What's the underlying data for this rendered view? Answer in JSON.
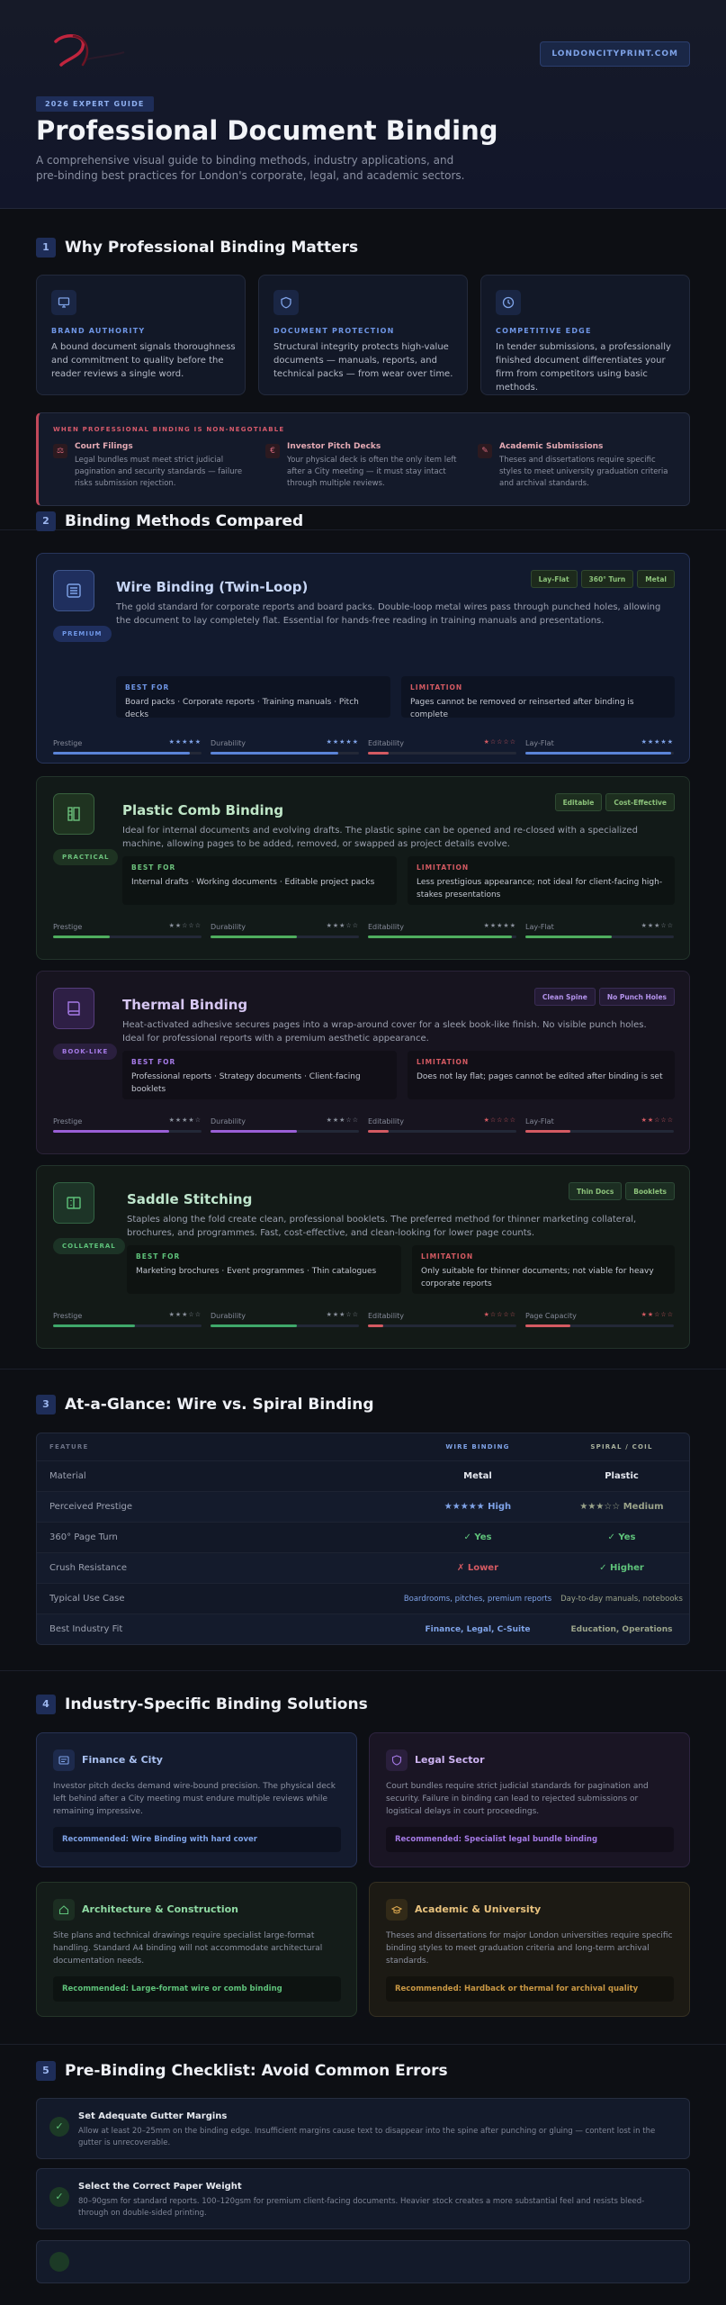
{
  "header": {
    "site_button": "LONDONCITYPRINT.COM",
    "badge": "2026 EXPERT GUIDE",
    "title": "Professional Document Binding",
    "subtitle": "A comprehensive visual guide to binding methods, industry applications, and pre-binding best practices for London's corporate, legal, and academic sectors."
  },
  "section1": {
    "number": "1",
    "title": "Why Professional Binding Matters",
    "cards": [
      {
        "icon": "monitor-icon",
        "eyebrow": "BRAND AUTHORITY",
        "text": "A bound document signals thoroughness and commitment to quality before the reader reviews a single word."
      },
      {
        "icon": "shield-icon",
        "eyebrow": "DOCUMENT PROTECTION",
        "text": "Structural integrity protects high-value documents — manuals, reports, and technical packs — from wear over time."
      },
      {
        "icon": "clock-icon",
        "eyebrow": "COMPETITIVE EDGE",
        "text": "In tender submissions, a professionally finished document differentiates your firm from competitors using basic methods."
      }
    ],
    "non_negotiable": {
      "label": "WHEN PROFESSIONAL BINDING IS NON-NEGOTIABLE",
      "items": [
        {
          "glyph": "⚖",
          "title": "Court Filings",
          "text": "Legal bundles must meet strict judicial pagination and security standards — failure risks submission rejection."
        },
        {
          "glyph": "€",
          "title": "Investor Pitch Decks",
          "text": "Your physical deck is often the only item left after a City meeting — it must stay intact through multiple reviews."
        },
        {
          "glyph": "✎",
          "title": "Academic Submissions",
          "text": "Theses and dissertations require specific styles to meet university graduation criteria and archival standards."
        }
      ]
    }
  },
  "section2": {
    "number": "2",
    "title": "Binding Methods Compared",
    "methods": [
      {
        "title": "Wire Binding (Twin-Loop)",
        "badge": "PREMIUM",
        "description": "The gold standard for corporate reports and board packs. Double-loop metal wires pass through punched holes, allowing the document to lay completely flat. Essential for hands-free reading in training manuals and presentations.",
        "tags": [
          "Lay-Flat",
          "360° Turn",
          "Metal"
        ],
        "best_for_label": "BEST FOR",
        "best_for": "Board packs · Corporate reports · Training manuals · Pitch decks",
        "limitation_label": "LIMITATION",
        "limitation": "Pages cannot be removed or reinserted after binding is complete",
        "metrics": [
          {
            "name": "Prestige",
            "stars": "★★★★★",
            "level": 0.92
          },
          {
            "name": "Durability",
            "stars": "★★★★★",
            "level": 0.86
          },
          {
            "name": "Editability",
            "stars": "★☆☆☆☆",
            "level": 0.14
          },
          {
            "name": "Lay-Flat",
            "stars": "★★★★★",
            "level": 0.98
          }
        ]
      },
      {
        "title": "Plastic Comb Binding",
        "badge": "PRACTICAL",
        "description": "Ideal for internal documents and evolving drafts. The plastic spine can be opened and re-closed with a specialized machine, allowing pages to be added, removed, or swapped as project details evolve.",
        "tags": [
          "Editable",
          "Cost-Effective"
        ],
        "best_for_label": "BEST FOR",
        "best_for": "Internal drafts · Working documents · Editable project packs",
        "limitation_label": "LIMITATION",
        "limitation": "Less prestigious appearance; not ideal for client-facing high-stakes presentations",
        "metrics": [
          {
            "name": "Prestige",
            "stars": "★★☆☆☆",
            "level": 0.38
          },
          {
            "name": "Durability",
            "stars": "★★★☆☆",
            "level": 0.58
          },
          {
            "name": "Editability",
            "stars": "★★★★★",
            "level": 0.97
          },
          {
            "name": "Lay-Flat",
            "stars": "★★★☆☆",
            "level": 0.58
          }
        ]
      },
      {
        "title": "Thermal Binding",
        "badge": "BOOK-LIKE",
        "description": "Heat-activated adhesive secures pages into a wrap-around cover for a sleek book-like finish. No visible punch holes. Ideal for professional reports with a premium aesthetic appearance.",
        "tags": [
          "Clean Spine",
          "No Punch Holes"
        ],
        "best_for_label": "BEST FOR",
        "best_for": "Professional reports · Strategy documents · Client-facing booklets",
        "limitation_label": "LIMITATION",
        "limitation": "Does not lay flat; pages cannot be edited after binding is set",
        "metrics": [
          {
            "name": "Prestige",
            "stars": "★★★★☆",
            "level": 0.78
          },
          {
            "name": "Durability",
            "stars": "★★★☆☆",
            "level": 0.58
          },
          {
            "name": "Editability",
            "stars": "★☆☆☆☆",
            "level": 0.14
          },
          {
            "name": "Lay-Flat",
            "stars": "★★☆☆☆",
            "level": 0.3
          }
        ]
      },
      {
        "title": "Saddle Stitching",
        "badge": "COLLATERAL",
        "description": "Staples along the fold create clean, professional booklets. The preferred method for thinner marketing collateral, brochures, and programmes. Fast, cost-effective, and clean-looking for lower page counts.",
        "tags": [
          "Thin Docs",
          "Booklets"
        ],
        "best_for_label": "BEST FOR",
        "best_for": "Marketing brochures · Event programmes · Thin catalogues",
        "limitation_label": "LIMITATION",
        "limitation": "Only suitable for thinner documents; not viable for heavy corporate reports",
        "metrics": [
          {
            "name": "Prestige",
            "stars": "★★★☆☆",
            "level": 0.55
          },
          {
            "name": "Durability",
            "stars": "★★★☆☆",
            "level": 0.58
          },
          {
            "name": "Editability",
            "stars": "★☆☆☆☆",
            "level": 0.1
          },
          {
            "name": "Page Capacity",
            "stars": "★★☆☆☆",
            "level": 0.3
          }
        ]
      }
    ]
  },
  "section3": {
    "number": "3",
    "title": "At-a-Glance: Wire vs. Spiral Binding",
    "headers": [
      "FEATURE",
      "WIRE BINDING",
      "SPIRAL / COIL"
    ],
    "rows": [
      {
        "feature": "Material",
        "wire": "Metal",
        "spiral": "Plastic"
      },
      {
        "feature": "Perceived Prestige",
        "wire": "★★★★★ High",
        "spiral": "★★★☆☆ Medium"
      },
      {
        "feature": "360° Page Turn",
        "wire": "✓ Yes",
        "spiral": "✓ Yes"
      },
      {
        "feature": "Crush Resistance",
        "wire": "✗ Lower",
        "spiral": "✓ Higher"
      },
      {
        "feature": "Typical Use Case",
        "wire": "Boardrooms, pitches, premium reports",
        "spiral": "Day-to-day manuals, notebooks"
      },
      {
        "feature": "Best Industry Fit",
        "wire": "Finance, Legal, C-Suite",
        "spiral": "Education, Operations"
      }
    ]
  },
  "section4": {
    "number": "4",
    "title": "Industry-Specific Binding Solutions",
    "industries": [
      {
        "title": "Finance & City",
        "icon": "chart-icon",
        "text": "Investor pitch decks demand wire-bound precision. The physical deck left behind after a City meeting must endure multiple reviews while remaining impressive.",
        "recommendation": "Recommended: Wire Binding with hard cover"
      },
      {
        "title": "Legal Sector",
        "icon": "shield-icon",
        "text": "Court bundles require strict judicial standards for pagination and security. Failure in binding can lead to rejected submissions or logistical delays in court proceedings.",
        "recommendation": "Recommended: Specialist legal bundle binding"
      },
      {
        "title": "Architecture & Construction",
        "icon": "home-icon",
        "text": "Site plans and technical drawings require specialist large-format handling. Standard A4 binding will not accommodate architectural documentation needs.",
        "recommendation": "Recommended: Large-format wire or comb binding"
      },
      {
        "title": "Academic & University",
        "icon": "graduation-cap-icon",
        "text": "Theses and dissertations for major London universities require specific binding styles to meet graduation criteria and long-term archival standards.",
        "recommendation": "Recommended: Hardback or thermal for archival quality"
      }
    ]
  },
  "section5": {
    "number": "5",
    "title": "Pre-Binding Checklist: Avoid Common Errors",
    "items": [
      {
        "title": "Set Adequate Gutter Margins",
        "text": "Allow at least 20–25mm on the binding edge. Insufficient margins cause text to disappear into the spine after punching or gluing — content lost in the gutter is unrecoverable."
      },
      {
        "title": "Select the Correct Paper Weight",
        "text": "80–90gsm for standard reports. 100–120gsm for premium client-facing documents. Heavier stock creates a more substantial feel and resists bleed-through on double-sided printing."
      },
      {
        "title": "",
        "text": ""
      }
    ]
  },
  "colors": {
    "wire": "#5b84d8",
    "comb": "#4fae5e",
    "thermal": "#9a5fd6",
    "saddle": "#3fa86a",
    "limitation": "#d45a62"
  }
}
